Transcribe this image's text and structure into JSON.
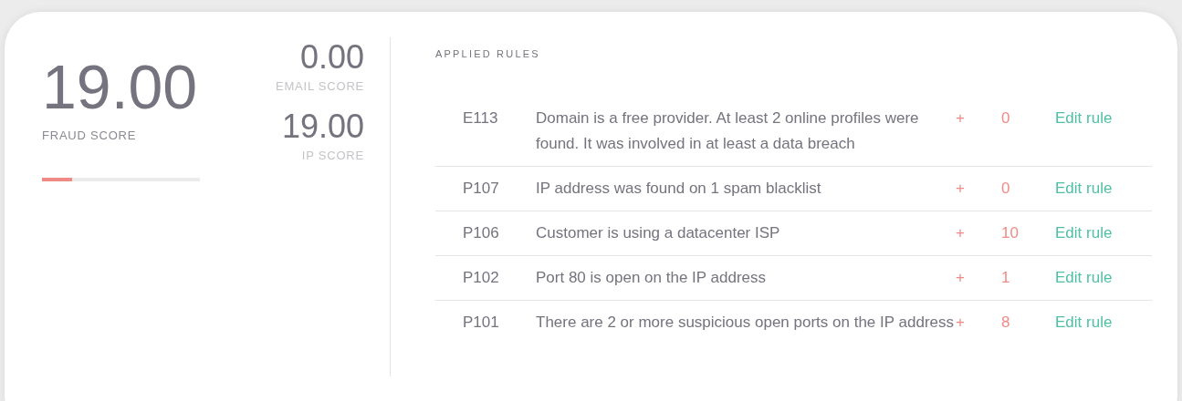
{
  "fraud_score": {
    "value": "19.00",
    "label": "FRAUD SCORE",
    "level": 0.19
  },
  "sub_scores": [
    {
      "value": "0.00",
      "label": "EMAIL SCORE"
    },
    {
      "value": "19.00",
      "label": "IP SCORE"
    }
  ],
  "applied_rules": {
    "title": "APPLIED RULES",
    "rows": [
      {
        "code": "E113",
        "description": "Domain is a free provider. At least 2 online profiles were found. It was involved in at least a data breach",
        "sign": "+",
        "points": "0",
        "action": "Edit rule"
      },
      {
        "code": "P107",
        "description": "IP address was found on 1 spam blacklist",
        "sign": "+",
        "points": "0",
        "action": "Edit rule"
      },
      {
        "code": "P106",
        "description": "Customer is using a datacenter ISP",
        "sign": "+",
        "points": "10",
        "action": "Edit rule"
      },
      {
        "code": "P102",
        "description": "Port 80 is open on the IP address",
        "sign": "+",
        "points": "1",
        "action": "Edit rule"
      },
      {
        "code": "P101",
        "description": "There are 2 or more suspicious open ports on the IP address",
        "sign": "+",
        "points": "8",
        "action": "Edit rule"
      }
    ]
  }
}
